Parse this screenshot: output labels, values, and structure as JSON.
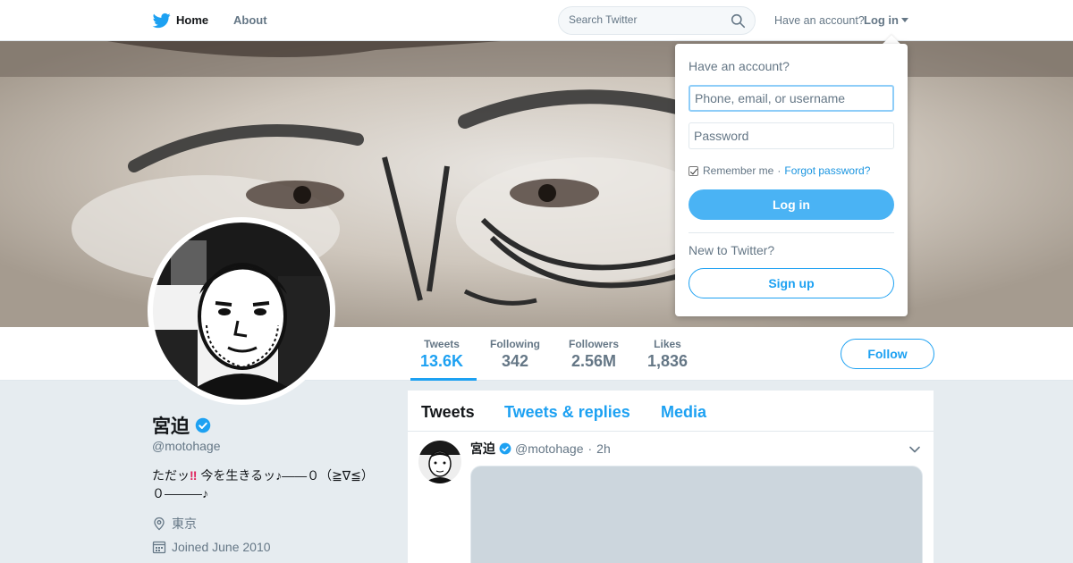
{
  "nav": {
    "home_label": "Home",
    "about_label": "About",
    "search_placeholder": "Search Twitter",
    "have_account": "Have an account?",
    "login_label": "Log in",
    "brand_color": "#1da1f2",
    "icons": [
      "twitter-bird-icon",
      "search-icon",
      "caret-down-icon"
    ]
  },
  "profile": {
    "name": "宮迫",
    "handle": "@motohage",
    "verified": true,
    "bio_line1_a": "ただッ",
    "bio_bang": "‼",
    "bio_line1_b": "今を生きるッ♪——０（≧∇≦）",
    "bio_line2": "０———♪",
    "location": "東京",
    "joined": "Joined June 2010"
  },
  "stats": [
    {
      "label": "Tweets",
      "value": "13.6K",
      "active": true
    },
    {
      "label": "Following",
      "value": "342",
      "active": false
    },
    {
      "label": "Followers",
      "value": "2.56M",
      "active": false
    },
    {
      "label": "Likes",
      "value": "1,836",
      "active": false
    }
  ],
  "follow_label": "Follow",
  "timeline": {
    "tabs": [
      {
        "label": "Tweets",
        "active": true
      },
      {
        "label": "Tweets & replies",
        "active": false
      },
      {
        "label": "Media",
        "active": false
      }
    ],
    "tweet": {
      "name": "宮迫",
      "handle": "@motohage",
      "separator": "·",
      "time": "2h"
    }
  },
  "login_dropdown": {
    "title": "Have an account?",
    "username_placeholder": "Phone, email, or username",
    "password_placeholder": "Password",
    "remember_label": "Remember me",
    "separator": "·",
    "forgot_label": "Forgot password?",
    "remember_checked": true,
    "login_button": "Log in",
    "new_to_twitter": "New to Twitter?",
    "signup_button": "Sign up"
  }
}
